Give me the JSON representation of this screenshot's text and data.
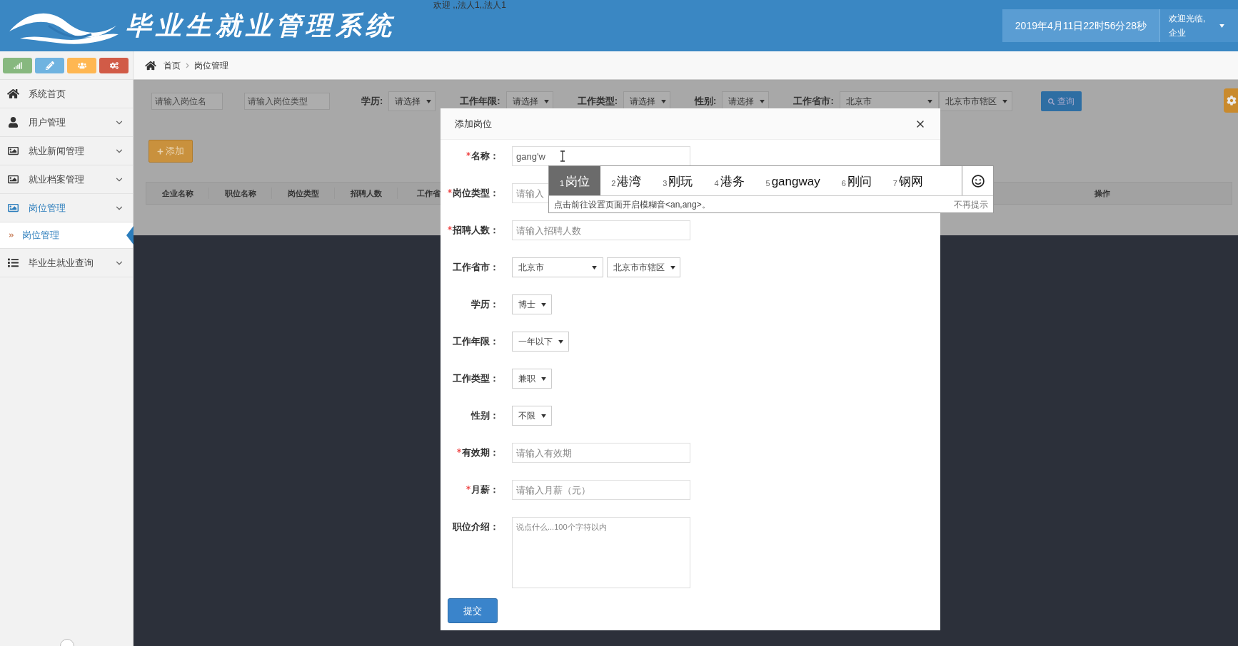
{
  "header": {
    "title": "毕业生就业管理系统",
    "welcome": "欢迎 ,,法人1,,法人1",
    "datetime": "2019年4月11日22时56分28秒",
    "greeting": "欢迎光临,",
    "role": "企业"
  },
  "toolbar": [
    {
      "kind": "chart",
      "color": "#87b87f"
    },
    {
      "kind": "pencil",
      "color": "#6fb3e0"
    },
    {
      "kind": "users",
      "color": "#ffb752"
    },
    {
      "kind": "gears",
      "color": "#d15b47"
    }
  ],
  "menu": [
    {
      "label": "系统首页",
      "kind": "link",
      "selected": false
    },
    {
      "label": "用户管理",
      "kind": "group",
      "selected": false
    },
    {
      "label": "就业新闻管理",
      "kind": "group",
      "selected": false
    },
    {
      "label": "就业档案管理",
      "kind": "group",
      "selected": false
    },
    {
      "label": "岗位管理",
      "kind": "group",
      "selected": true,
      "expanded": true,
      "children": [
        {
          "label": "岗位管理",
          "selected": true
        }
      ]
    },
    {
      "label": "毕业生就业查询",
      "kind": "group",
      "selected": false
    }
  ],
  "breadcrumb": [
    "首页",
    "岗位管理"
  ],
  "filters": {
    "inputs": [
      {
        "placeholder": "请输入岗位名"
      },
      {
        "placeholder": "请输入岗位类型"
      }
    ],
    "selects": [
      {
        "label": "学历:",
        "values": [
          "请选择"
        ]
      },
      {
        "label": "工作年限:",
        "values": [
          "请选择"
        ]
      },
      {
        "label": "工作类型:",
        "values": [
          "请选择"
        ]
      },
      {
        "label": "性别:",
        "values": [
          "请选择"
        ]
      },
      {
        "label": "工作省市:",
        "values": [
          "北京市",
          "北京市市辖区"
        ]
      }
    ],
    "search_button": "查询"
  },
  "add_button": "添加",
  "table": {
    "columns": [
      "企业名称",
      "职位名称",
      "岗位类型",
      "招聘人数",
      "工作省",
      "操作"
    ]
  },
  "modal": {
    "title": "添加岗位",
    "fields": [
      {
        "label": "名称：",
        "required": true,
        "kind": "text",
        "value": "gang'w"
      },
      {
        "label": "岗位类型：",
        "required": true,
        "kind": "text",
        "placeholder": "请输入"
      },
      {
        "label": "招聘人数：",
        "required": true,
        "kind": "text",
        "placeholder": "请输入招聘人数"
      },
      {
        "label": "工作省市：",
        "required": false,
        "kind": "select",
        "values": [
          "北京市",
          "北京市市辖区"
        ]
      },
      {
        "label": "学历：",
        "required": false,
        "kind": "select",
        "values": [
          "博士"
        ]
      },
      {
        "label": "工作年限：",
        "required": false,
        "kind": "select",
        "values": [
          "一年以下"
        ]
      },
      {
        "label": "工作类型：",
        "required": false,
        "kind": "select",
        "values": [
          "兼职"
        ]
      },
      {
        "label": "性别：",
        "required": false,
        "kind": "select",
        "values": [
          "不限"
        ]
      },
      {
        "label": "有效期：",
        "required": true,
        "kind": "text",
        "placeholder": "请输入有效期"
      },
      {
        "label": "月薪：",
        "required": true,
        "kind": "text",
        "placeholder": "请输入月薪（元）"
      },
      {
        "label": "职位介绍：",
        "required": false,
        "kind": "textarea",
        "placeholder": "说点什么...100个字符以内"
      }
    ],
    "submit": "提交"
  },
  "ime": {
    "candidates": [
      {
        "index": "1",
        "text": "岗位",
        "selected": true
      },
      {
        "index": "2",
        "text": "港湾",
        "selected": false
      },
      {
        "index": "3",
        "text": "刚玩",
        "selected": false
      },
      {
        "index": "4",
        "text": "港务",
        "selected": false
      },
      {
        "index": "5",
        "text": "gangway",
        "selected": false
      },
      {
        "index": "6",
        "text": "刚问",
        "selected": false
      },
      {
        "index": "7",
        "text": "钢网",
        "selected": false
      }
    ],
    "hint": "点击前往设置页面开启模糊音<an,ang>。",
    "dismiss": "不再提示"
  }
}
